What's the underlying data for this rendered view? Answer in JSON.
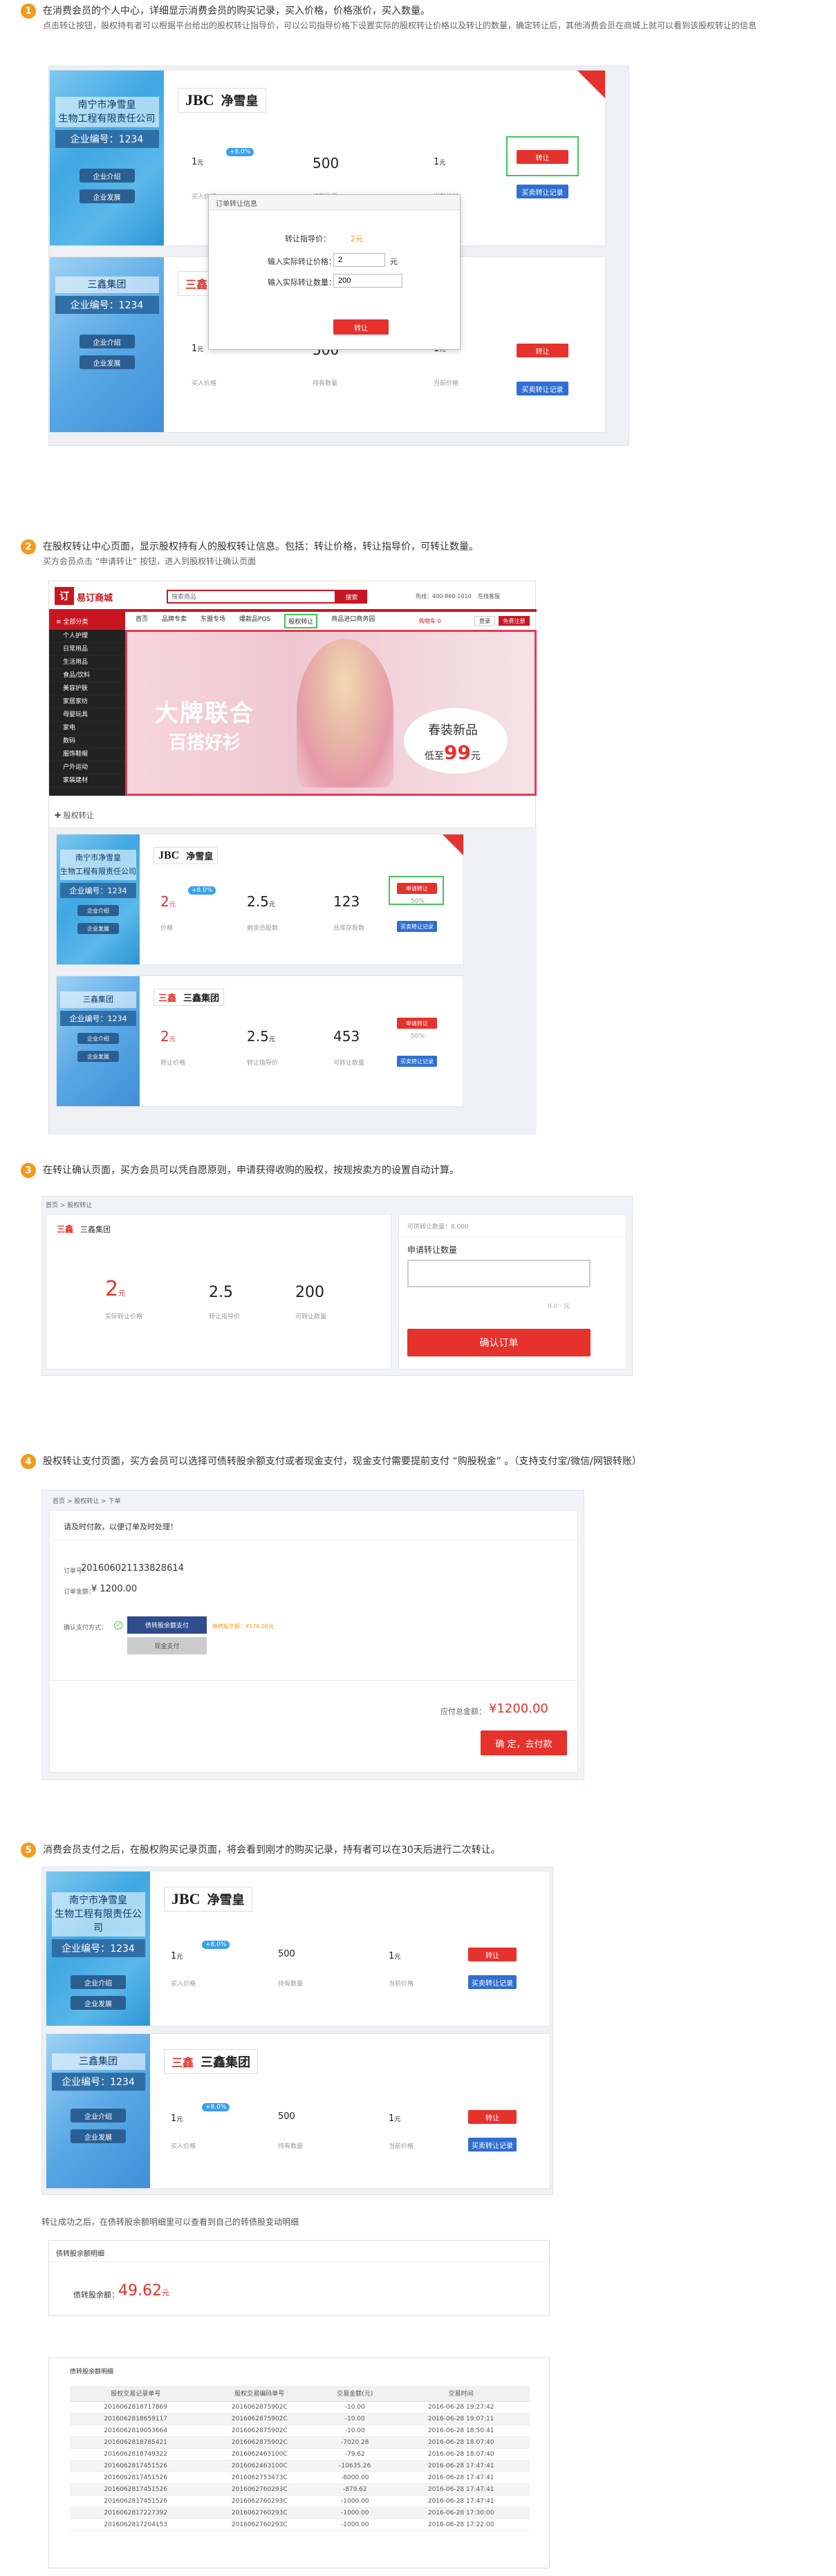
{
  "steps": [
    {
      "num": "1",
      "text": "在消费会员的个人中心，详细显示消费会员的购买记录，买入价格，价格涨价，买入数量。",
      "sub": "点击转让按钮，股权持有者可以根据平台给出的股权转让指导价，可以公司指导价格下设置实际的股权转让价格以及转让的数量，确定转让后，其他消费会员在商城上就可以看到该股权转让的信息"
    },
    {
      "num": "2",
      "text": "在股权转让中心页面，显示股权持有人的股权转让信息。包括：转让价格，转让指导价，可转让数量。",
      "sub": "买方会员点击 “申请转让” 按钮，进入到股权转让确认页面"
    },
    {
      "num": "3",
      "text": "在转让确认页面，买方会员可以凭自愿原则，申请获得收购的股权，按规按卖方的设置自动计算。",
      "sub": ""
    },
    {
      "num": "4",
      "text": "股权转让支付页面，买方会员可以选择可债转股余额支付或者现金支付，现金支付需要提前支付 “购股税金” 。（支持支付宝/微信/网银转账）",
      "sub": ""
    },
    {
      "num": "5",
      "text": "消费会员支付之后，在股权购买记录页面，将会看到刚才的购买记录，持有者可以在30天后进行二次转让。",
      "sub": ""
    }
  ],
  "companies": {
    "jsh": {
      "name": "南宁市净雪皇\n生物工程有限责任公司",
      "no": "企业编号：1234",
      "logo_mark": "JBC",
      "logo_name": "净雪皇"
    },
    "sx": {
      "name": "三鑫集团",
      "no": "企业编号：1234",
      "logo_mark": "三鑫",
      "logo_name": "三鑫集团"
    }
  },
  "card_buttons": {
    "intro": "企业介绍",
    "detail": "企业发展",
    "transfer": "转让",
    "record": "买卖转让记录",
    "apply": "申请转让"
  },
  "card_values": {
    "price": "1",
    "unit": "元",
    "qty": "500",
    "price2": "1",
    "badge": "+8.0%",
    "cap_price": "买入价格",
    "cap_qty": "持有数量",
    "cap_cur": "当前价格"
  },
  "modal": {
    "title": "订单转让信息",
    "guide_label": "转让指导价：",
    "guide_value": "2元",
    "price_label": "输入实际转让价格：",
    "price_value": "2",
    "price_unit": "元",
    "qty_label": "输入实际转让数量：",
    "qty_value": "200",
    "confirm": "转让"
  },
  "site": {
    "logo": "易订商城",
    "search_placeholder": "搜索商品",
    "search_btn": "搜索",
    "hotline": "热线：400-860-1010",
    "service": "在线客服",
    "nav": [
      "首页",
      "品牌专卖",
      "东盟专场",
      "爆款品POS",
      "股权转让",
      "商品进口商务园"
    ],
    "cart": "购物车 0",
    "login": "登录",
    "register": "免费注册",
    "menu": [
      "个人护理",
      "日常用品",
      "生活用品",
      "食品/饮料",
      "美容护肤",
      "家居家纺",
      "母婴玩具",
      "家电",
      "数码",
      "服饰鞋帽",
      "户外运动",
      "家装建材"
    ],
    "banner_title": "大牌联合",
    "banner_sub": "百搭好衫",
    "banner_slogan": "春装新品",
    "banner_price_prefix": "低至",
    "banner_price": "99",
    "banner_price_unit": "元",
    "section": "股权转让"
  },
  "market": [
    {
      "price": "2",
      "guide": "2.5",
      "qty": "123",
      "cap1": "价格",
      "cap2": "剩余总股数",
      "cap3": "总库存股数",
      "pct": "50%"
    },
    {
      "price": "2",
      "guide": "2.5",
      "qty": "453",
      "cap1": "转让价格",
      "cap2": "转让指导价",
      "cap3": "可转让数量",
      "pct": "50%"
    }
  ],
  "confirm_page": {
    "crumb": "首页 > 股权转让",
    "company": "三鑫集团",
    "price": "2",
    "unit": "元",
    "guide": "2.5",
    "qty": "200",
    "cap1": "实际转让价格",
    "cap2": "转让指导价",
    "cap3": "可转让数量",
    "avail": "可供转让数量：8,000",
    "qty_label": "申请转让数量",
    "count": "0.0",
    "count_unit": "元",
    "submit": "确认订单"
  },
  "pay_page": {
    "crumb": "首页 > 股权转让 > 下单",
    "notice": "请及时付款，以便订单及时处理！",
    "order_label": "订单号：",
    "order_no": "20160602113382861​4",
    "amount_label": "订单金额：",
    "amount": "¥ 1200.00",
    "method_label": "确认支付方式：",
    "opt1": "债转股余额支付",
    "opt2": "现金支付",
    "opt1_note": "债转股余额：¥176.00元",
    "total_label": "应付总金额：",
    "total": "¥1200.00",
    "pay_btn": "确 定，去付款"
  },
  "balance": {
    "caption": "转让成功之后，在债转股余额明细里可以查看到自己的转债股变动明细",
    "title": "债转股余额明细",
    "label": "债转股余额：",
    "value": "49.62",
    "unit": "元",
    "ledger_title": "债转股余额明细",
    "headers": [
      "股权交易记录单号",
      "股权交易编码单号",
      "交易金额(元)",
      "交易时间"
    ],
    "rows": [
      [
        "2016062818717869",
        "2016062875902C",
        "-10.00",
        "2016-06-28 19:27:42"
      ],
      [
        "2016062818659117",
        "2016062875902C",
        "-10.00",
        "2016-06-28 19:07:11"
      ],
      [
        "2016062819053664",
        "2016062875902C",
        "-10.00",
        "2016-06-28 18:50:41"
      ],
      [
        "2016062818785421",
        "2016062875902C",
        "-7020.28",
        "2016-06-28 18:07:40"
      ],
      [
        "2016062818749322",
        "2016062463100C",
        "-79.62",
        "2016-06-28 18:07:40"
      ],
      [
        "2016062817451526",
        "2016062463100C",
        "-10635.26",
        "2016-06-28 17:47:41"
      ],
      [
        "2016062817451526",
        "2016062753473C",
        "-8000.00",
        "2016-06-28 17:47:41"
      ],
      [
        "2016062817451526",
        "2016062760293C",
        "-879.62",
        "2016-06-28 17:47:41"
      ],
      [
        "2016062817451526",
        "2016062760293C",
        "-1000.00",
        "2016-06-28 17:47:41"
      ],
      [
        "2016062817227392",
        "2016062760293C",
        "-1000.00",
        "2016-06-28 17:30:00"
      ],
      [
        "2016062817204153",
        "2016062760293C",
        "-1000.00",
        "2016-06-28 17:22:00"
      ]
    ]
  },
  "colors": {
    "accent": "#e5322d",
    "step": "#f39a1f",
    "blue": "#2f6fd1",
    "green": "#43c45a"
  }
}
